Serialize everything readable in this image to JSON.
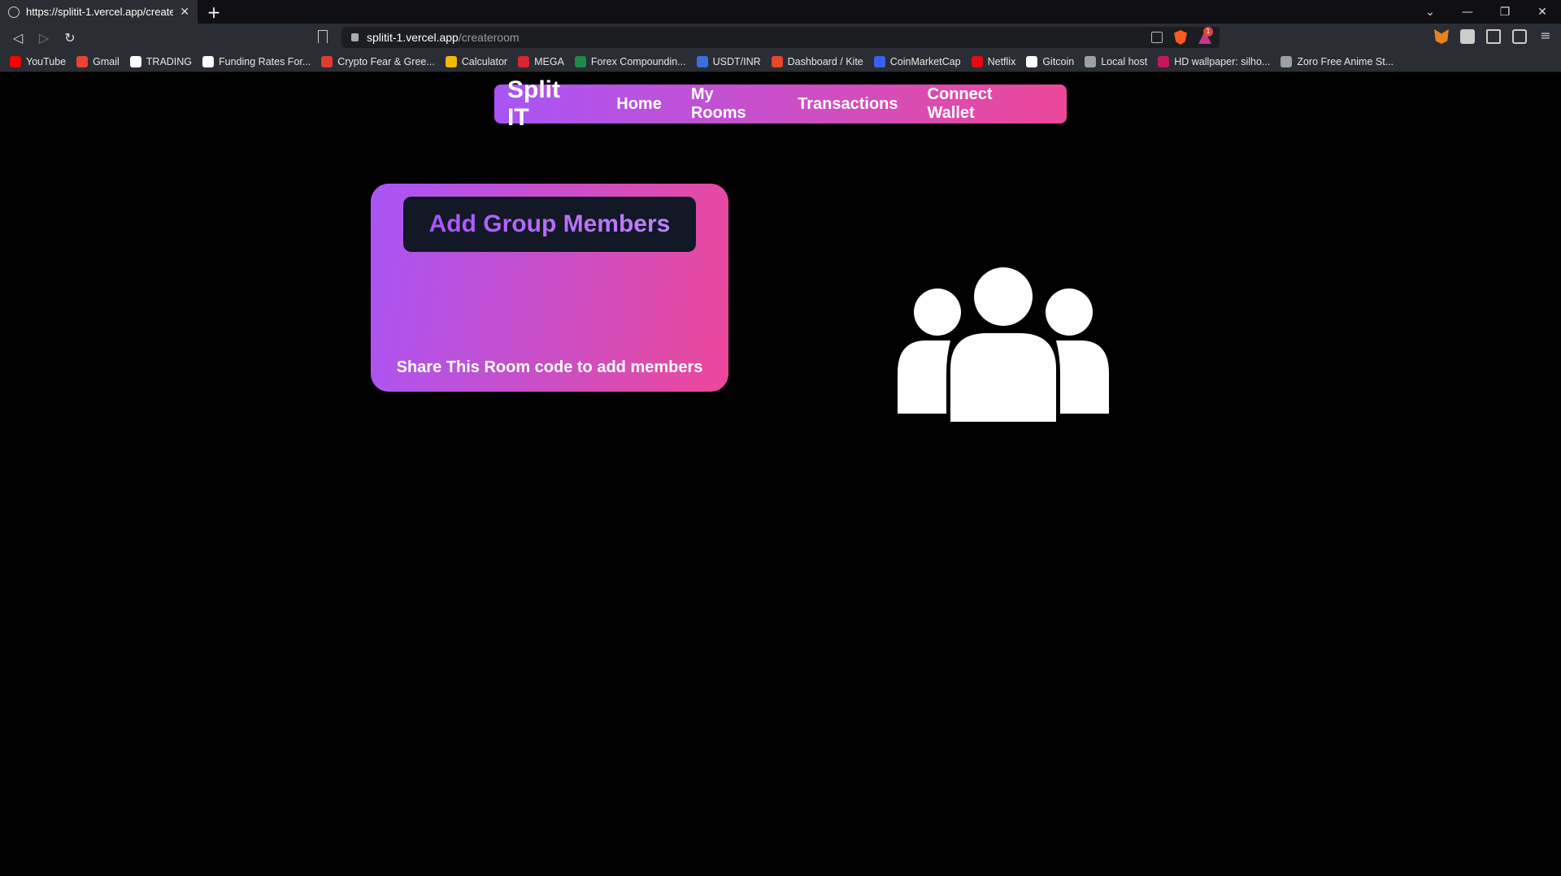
{
  "browser": {
    "tab_title": "https://splitit-1.vercel.app/createroom",
    "tab_close": "✕",
    "new_tab": "+",
    "url_host": "splitit-1.vercel.app",
    "url_path": "/createroom",
    "badge_count": "1",
    "window_controls": [
      "⌄",
      "—",
      "❐",
      "✕"
    ],
    "bookmarks": [
      {
        "label": "YouTube",
        "color": "#ff0000"
      },
      {
        "label": "Gmail",
        "color": "#ea4335"
      },
      {
        "label": "TRADING",
        "color": "#ffffff"
      },
      {
        "label": "Funding Rates For...",
        "color": "#ffffff"
      },
      {
        "label": "Crypto Fear & Gree...",
        "color": "#e03c31"
      },
      {
        "label": "Calculator",
        "color": "#f0b90b"
      },
      {
        "label": "MEGA",
        "color": "#d9272e"
      },
      {
        "label": "Forex Compoundin...",
        "color": "#1f8a4c"
      },
      {
        "label": "USDT/INR",
        "color": "#3b6fe0"
      },
      {
        "label": "Dashboard / Kite",
        "color": "#e8472c"
      },
      {
        "label": "CoinMarketCap",
        "color": "#3861fb"
      },
      {
        "label": "Netflix",
        "color": "#e50914"
      },
      {
        "label": "Gitcoin",
        "color": "#ffffff"
      },
      {
        "label": "Local host",
        "color": "#9aa0a6"
      },
      {
        "label": "HD wallpaper: silho...",
        "color": "#c2185b"
      },
      {
        "label": "Zoro Free Anime St...",
        "color": "#9aa0a6"
      }
    ]
  },
  "nav": {
    "brand": "Split IT",
    "links": [
      "Home",
      "My Rooms",
      "Transactions",
      "Connect Wallet"
    ],
    "gradient": [
      "#a855f7",
      "#ec4899"
    ]
  },
  "card": {
    "button_label": "Add Group Members",
    "caption": "Share This Room code to add members"
  },
  "icons": {
    "group": "group-users-icon"
  }
}
